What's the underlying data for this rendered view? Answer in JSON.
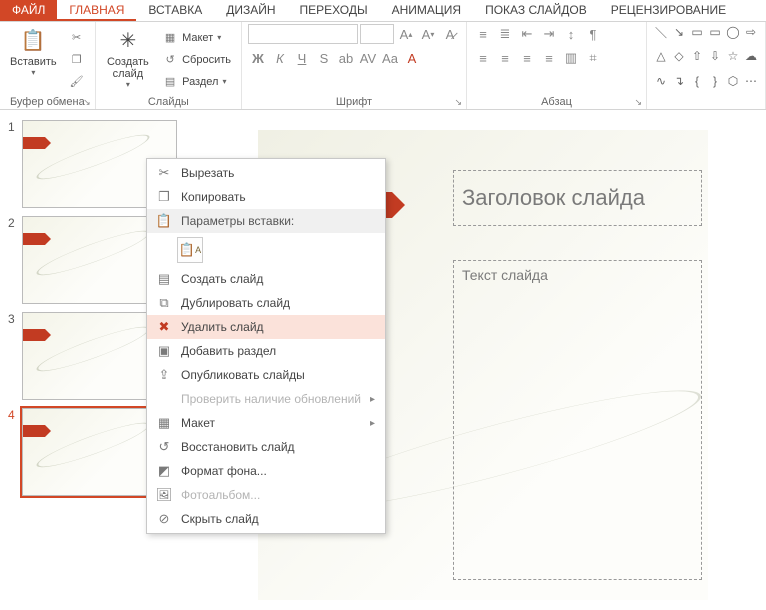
{
  "tabs": {
    "file": "ФАЙЛ",
    "home": "ГЛАВНАЯ",
    "insert": "ВСТАВКА",
    "design": "ДИЗАЙН",
    "transitions": "ПЕРЕХОДЫ",
    "animation": "АНИМАЦИЯ",
    "slideshow": "ПОКАЗ СЛАЙДОВ",
    "review": "РЕЦЕНЗИРОВАНИЕ"
  },
  "ribbon": {
    "clipboard": {
      "paste": "Вставить",
      "label": "Буфер обмена"
    },
    "slides": {
      "new": "Создать слайд",
      "layout": "Макет",
      "reset": "Сбросить",
      "section": "Раздел",
      "label": "Слайды"
    },
    "font": {
      "label": "Шрифт"
    },
    "paragraph": {
      "label": "Абзац"
    }
  },
  "slide": {
    "title_placeholder": "Заголовок слайда",
    "body_placeholder": "Текст слайда"
  },
  "thumbs": [
    "1",
    "2",
    "3",
    "4"
  ],
  "ctx": {
    "cut": "Вырезать",
    "copy": "Копировать",
    "paste_header": "Параметры вставки:",
    "new_slide": "Создать слайд",
    "duplicate": "Дублировать слайд",
    "delete": "Удалить слайд",
    "add_section": "Добавить раздел",
    "publish": "Опубликовать слайды",
    "check_updates": "Проверить наличие обновлений",
    "layout": "Макет",
    "restore": "Восстановить слайд",
    "format_bg": "Формат фона...",
    "photo_album": "Фотоальбом...",
    "hide": "Скрыть слайд"
  }
}
